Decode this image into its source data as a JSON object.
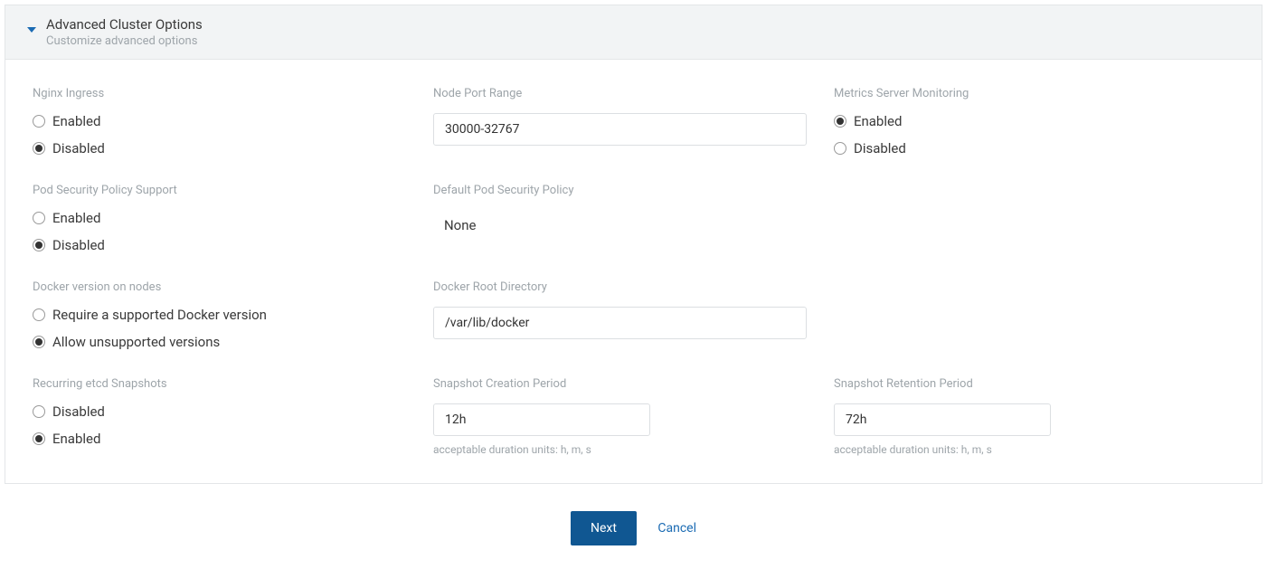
{
  "header": {
    "title": "Advanced Cluster Options",
    "subtitle": "Customize advanced options"
  },
  "nginx_ingress": {
    "label": "Nginx Ingress",
    "options": {
      "enabled": "Enabled",
      "disabled": "Disabled"
    },
    "selected": "disabled"
  },
  "node_port_range": {
    "label": "Node Port Range",
    "value": "30000-32767"
  },
  "metrics_server": {
    "label": "Metrics Server Monitoring",
    "options": {
      "enabled": "Enabled",
      "disabled": "Disabled"
    },
    "selected": "enabled"
  },
  "pod_security": {
    "label": "Pod Security Policy Support",
    "options": {
      "enabled": "Enabled",
      "disabled": "Disabled"
    },
    "selected": "disabled"
  },
  "default_pod_security": {
    "label": "Default Pod Security Policy",
    "value": "None"
  },
  "docker_version": {
    "label": "Docker version on nodes",
    "options": {
      "require": "Require a supported Docker version",
      "allow": "Allow unsupported versions"
    },
    "selected": "allow"
  },
  "docker_root": {
    "label": "Docker Root Directory",
    "value": "/var/lib/docker"
  },
  "etcd_snapshots": {
    "label": "Recurring etcd Snapshots",
    "options": {
      "disabled": "Disabled",
      "enabled": "Enabled"
    },
    "selected": "enabled"
  },
  "snapshot_creation": {
    "label": "Snapshot Creation Period",
    "value": "12h",
    "hint": "acceptable duration units: h, m, s"
  },
  "snapshot_retention": {
    "label": "Snapshot Retention Period",
    "value": "72h",
    "hint": "acceptable duration units: h, m, s"
  },
  "footer": {
    "next": "Next",
    "cancel": "Cancel"
  }
}
